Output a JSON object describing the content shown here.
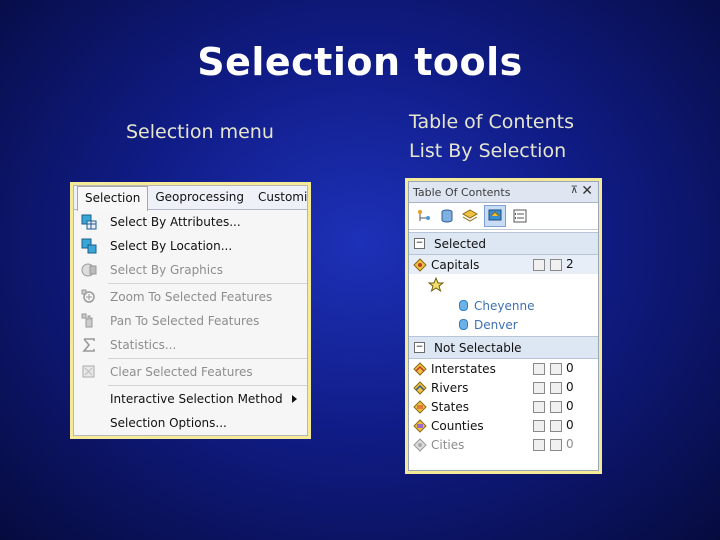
{
  "slide": {
    "title": "Selection tools",
    "left_caption": "Selection menu",
    "right_caption_line1": "Table of Contents",
    "right_caption_line2": "List By Selection"
  },
  "menu": {
    "bar": [
      "Selection",
      "Geoprocessing",
      "Customiz"
    ],
    "items": [
      {
        "label": "Select By Attributes...",
        "enabled": true,
        "icon": "select-attributes-icon"
      },
      {
        "label": "Select By Location...",
        "enabled": true,
        "icon": "select-location-icon"
      },
      {
        "label": "Select By Graphics",
        "enabled": false,
        "icon": "select-graphics-icon"
      },
      {
        "label": "Zoom To Selected Features",
        "enabled": false,
        "icon": "zoom-selected-icon"
      },
      {
        "label": "Pan To Selected Features",
        "enabled": false,
        "icon": "pan-selected-icon"
      },
      {
        "label": "Statistics...",
        "enabled": false,
        "icon": "sigma-icon"
      },
      {
        "label": "Clear Selected Features",
        "enabled": false,
        "icon": "clear-selection-icon"
      },
      {
        "label": "Interactive Selection Method",
        "enabled": true,
        "submenu": true
      },
      {
        "label": "Selection Options...",
        "enabled": true
      }
    ]
  },
  "toc": {
    "title": "Table Of Contents",
    "pin": "⊼",
    "close": "✕",
    "tools": [
      "list-by-drawing-order-icon",
      "list-by-source-icon",
      "list-by-visibility-icon",
      "list-by-selection-icon",
      "options-icon"
    ],
    "groups": [
      {
        "name": "Selected",
        "toggle": "−",
        "layers": [
          {
            "name": "Capitals",
            "count": "2",
            "dim": false,
            "selected": true
          }
        ],
        "features": [
          "Cheyenne",
          "Denver"
        ]
      },
      {
        "name": "Not Selectable",
        "toggle": "−",
        "layers": [
          {
            "name": "Interstates",
            "count": "0",
            "dim": false
          },
          {
            "name": "Rivers",
            "count": "0",
            "dim": false
          },
          {
            "name": "States",
            "count": "0",
            "dim": false
          },
          {
            "name": "Counties",
            "count": "0",
            "dim": false
          },
          {
            "name": "Cities",
            "count": "0",
            "dim": true
          }
        ]
      }
    ]
  },
  "colors": {
    "background": "#101c86",
    "frame": "#f4ea98",
    "caption": "#e6e6cf"
  }
}
